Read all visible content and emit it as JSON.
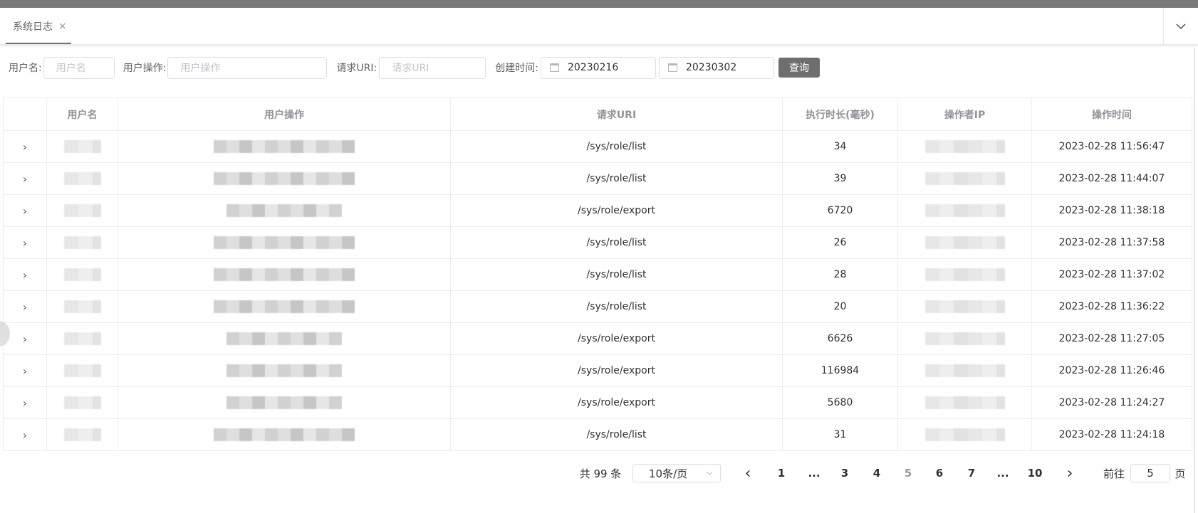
{
  "tabs": {
    "active_label": "系统日志",
    "close_glyph": "×"
  },
  "filters": {
    "username_label": "用户名:",
    "username_placeholder": "用户名",
    "operation_label": "用户操作:",
    "operation_placeholder": "用户操作",
    "uri_label": "请求URI:",
    "uri_placeholder": "请求URI",
    "created_label": "创建时间:",
    "start_date": "20230216",
    "end_date": "20230302",
    "query_button": "查询"
  },
  "table": {
    "headers": [
      "",
      "用户名",
      "用户操作",
      "请求URI",
      "执行时长(毫秒)",
      "操作者IP",
      "操作时间"
    ],
    "rows": [
      {
        "uri": "/sys/role/list",
        "duration": "34",
        "time": "2023-02-28 11:56:47"
      },
      {
        "uri": "/sys/role/list",
        "duration": "39",
        "time": "2023-02-28 11:44:07"
      },
      {
        "uri": "/sys/role/export",
        "duration": "6720",
        "time": "2023-02-28 11:38:18"
      },
      {
        "uri": "/sys/role/list",
        "duration": "26",
        "time": "2023-02-28 11:37:58"
      },
      {
        "uri": "/sys/role/list",
        "duration": "28",
        "time": "2023-02-28 11:37:02"
      },
      {
        "uri": "/sys/role/list",
        "duration": "20",
        "time": "2023-02-28 11:36:22"
      },
      {
        "uri": "/sys/role/export",
        "duration": "6626",
        "time": "2023-02-28 11:27:05"
      },
      {
        "uri": "/sys/role/export",
        "duration": "116984",
        "time": "2023-02-28 11:26:46"
      },
      {
        "uri": "/sys/role/export",
        "duration": "5680",
        "time": "2023-02-28 11:24:27"
      },
      {
        "uri": "/sys/role/list",
        "duration": "31",
        "time": "2023-02-28 11:24:18"
      }
    ]
  },
  "pagination": {
    "total": "共 99 条",
    "page_size": "10条/页",
    "prev": "‹",
    "pages": [
      "1",
      "...",
      "3",
      "4",
      "5",
      "6",
      "7",
      "...",
      "10"
    ],
    "current_page": "5",
    "next": "›",
    "goto_label": "前往",
    "goto_value": "5",
    "page_suffix": "页"
  },
  "icons": {
    "tab_menu": "chevron-down-icon",
    "expand_row": "chevron-right-icon",
    "calendar": "calendar-icon"
  },
  "colors": {
    "query_button": "#6e6e6e",
    "tab_underline": "#707070",
    "header_text": "#909399"
  }
}
